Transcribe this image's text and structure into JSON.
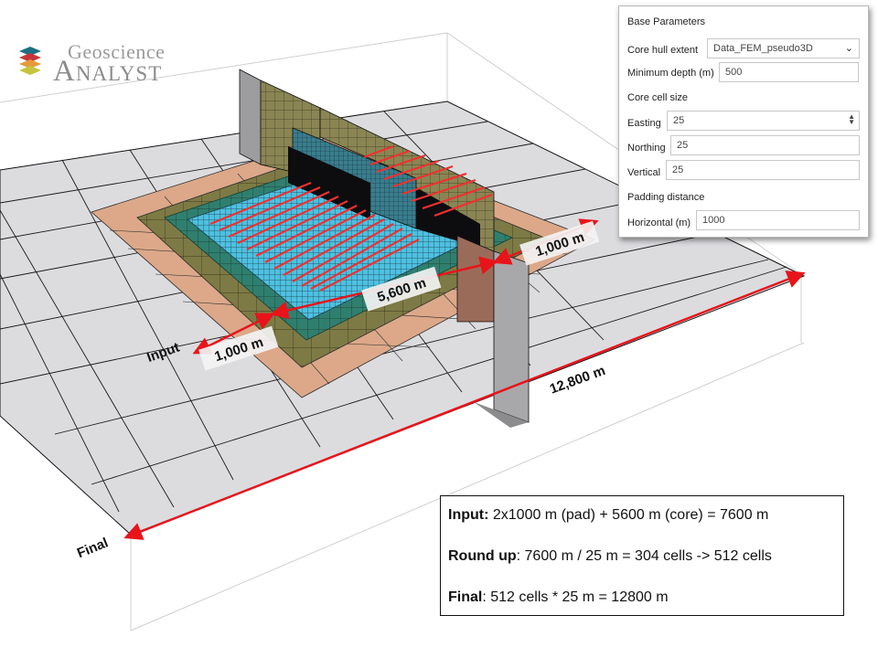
{
  "app": {
    "logo_line1": "Geoscience",
    "logo_line2": "Analyst"
  },
  "panel": {
    "base_parameters": "Base Parameters",
    "core_hull_extent_label": "Core hull extent",
    "core_hull_extent_value": "Data_FEM_pseudo3D",
    "minimum_depth_label": "Minimum depth (m)",
    "minimum_depth_value": "500",
    "core_cell_size": "Core cell size",
    "easting_label": "Easting",
    "easting_value": "25",
    "northing_label": "Northing",
    "northing_value": "25",
    "vertical_label": "Vertical",
    "vertical_value": "25",
    "padding_distance": "Padding distance",
    "horizontal_label": "Horizontal (m)",
    "horizontal_value": "1000"
  },
  "scene": {
    "label_input": "Input",
    "label_final": "Final",
    "dim_pad_left": "1,000 m",
    "dim_core": "5,600 m",
    "dim_pad_right": "1,000 m",
    "dim_final": "12,800 m",
    "colors": {
      "arrow": "#e8141a",
      "pad_tan": "#dca889",
      "pad_olive": "#7d7a45",
      "core_teal": "#2f7f6f",
      "core_cyan": "#4ec0e0",
      "grid_gray": "#d9d9dc",
      "data_red": "#f03030"
    }
  },
  "infobox": {
    "line1_bold": "Input:",
    "line1_rest": " 2x1000 m (pad) + 5600 m (core) = 7600 m",
    "line2_bold": "Round up",
    "line2_rest": ": 7600 m / 25 m = 304 cells -> 512 cells",
    "line3_bold": "Final",
    "line3_rest": ": 512 cells * 25 m = 12800 m"
  }
}
